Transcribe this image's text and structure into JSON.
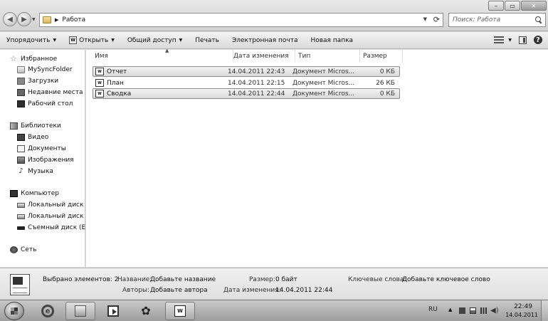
{
  "address": {
    "crumb": "Работа"
  },
  "search": {
    "placeholder": "Поиск: Работа"
  },
  "window": {
    "minimize": "–",
    "maximize": "▭",
    "close": "✕"
  },
  "toolbar": {
    "organize": "Упорядочить",
    "open": "Открыть",
    "share": "Общий доступ",
    "print": "Печать",
    "email": "Электронная почта",
    "new_folder": "Новая папка"
  },
  "nav": {
    "favorites": "Избранное",
    "fav_items": [
      "MySyncFolder",
      "Загрузки",
      "Недавние места",
      "Рабочий стол"
    ],
    "libraries": "Библиотеки",
    "lib_items": [
      "Видео",
      "Документы",
      "Изображения",
      "Музыка"
    ],
    "computer": "Компьютер",
    "comp_items": [
      "Локальный диск (C",
      "Локальный диск (D",
      "Съемный диск (E:)"
    ],
    "network": "Сеть"
  },
  "columns": {
    "name": "Имя",
    "date": "Дата изменения",
    "type": "Тип",
    "size": "Размер"
  },
  "files": [
    {
      "name": "Отчет",
      "date": "14.04.2011 22:43",
      "type": "Документ Micros...",
      "size": "0 КБ"
    },
    {
      "name": "План",
      "date": "14.04.2011 22:15",
      "type": "Документ Micros...",
      "size": "26 КБ"
    },
    {
      "name": "Сводка",
      "date": "14.04.2011 22:44",
      "type": "Документ Micros...",
      "size": "0 КБ"
    }
  ],
  "details": {
    "selected": "Выбрано элементов: 2",
    "title_label": "Название:",
    "title_value": "Добавьте название",
    "authors_label": "Авторы:",
    "authors_value": "Добавьте автора",
    "size_label": "Размер:",
    "size_value": "0 байт",
    "modified_label": "Дата изменения:",
    "modified_value": "14.04.2011 22:44",
    "keywords_label": "Ключевые слова:",
    "keywords_value": "Добавьте ключевое слово"
  },
  "taskbar": {
    "lang": "RU",
    "time": "22:49",
    "date": "14.04.2011",
    "word_icon_text": "W"
  },
  "icons": {
    "back": "back-arrow-icon",
    "forward": "forward-arrow-icon",
    "search": "search-icon",
    "view": "view-options-icon",
    "preview": "preview-pane-icon",
    "help": "help-icon"
  }
}
